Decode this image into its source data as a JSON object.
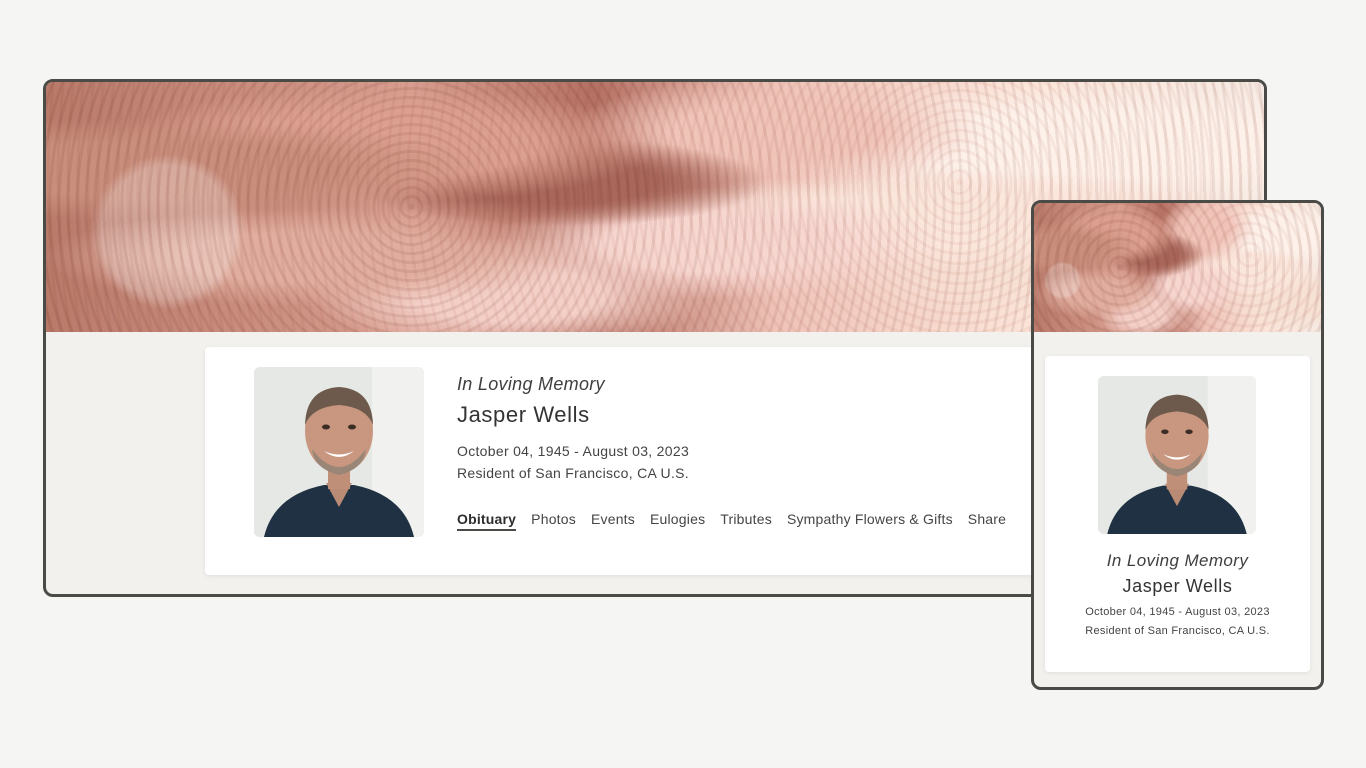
{
  "desktop": {
    "memory_label": "In Loving Memory",
    "name": "Jasper Wells",
    "dates": "October 04, 1945 - August 03, 2023",
    "resident": "Resident of San Francisco, CA U.S.",
    "tabs": [
      {
        "label": "Obituary",
        "active": true
      },
      {
        "label": "Photos",
        "active": false
      },
      {
        "label": "Events",
        "active": false
      },
      {
        "label": "Eulogies",
        "active": false
      },
      {
        "label": "Tributes",
        "active": false
      },
      {
        "label": "Sympathy Flowers & Gifts",
        "active": false
      },
      {
        "label": "Share",
        "active": false
      }
    ]
  },
  "mobile": {
    "memory_label": "In Loving Memory",
    "name": "Jasper Wells",
    "dates": "October 04, 1945 - August 03, 2023",
    "resident": "Resident of San Francisco, CA U.S."
  },
  "colors": {
    "page_background": "#f5f5f4",
    "frame_border": "#4a4b47",
    "content_background": "#f2f1ee",
    "card_background": "#ffffff",
    "text": "#3a3a3a"
  },
  "icons": {
    "banner": "pink-carnation-flowers-banner",
    "portrait": "smiling-man-portrait-photo"
  }
}
